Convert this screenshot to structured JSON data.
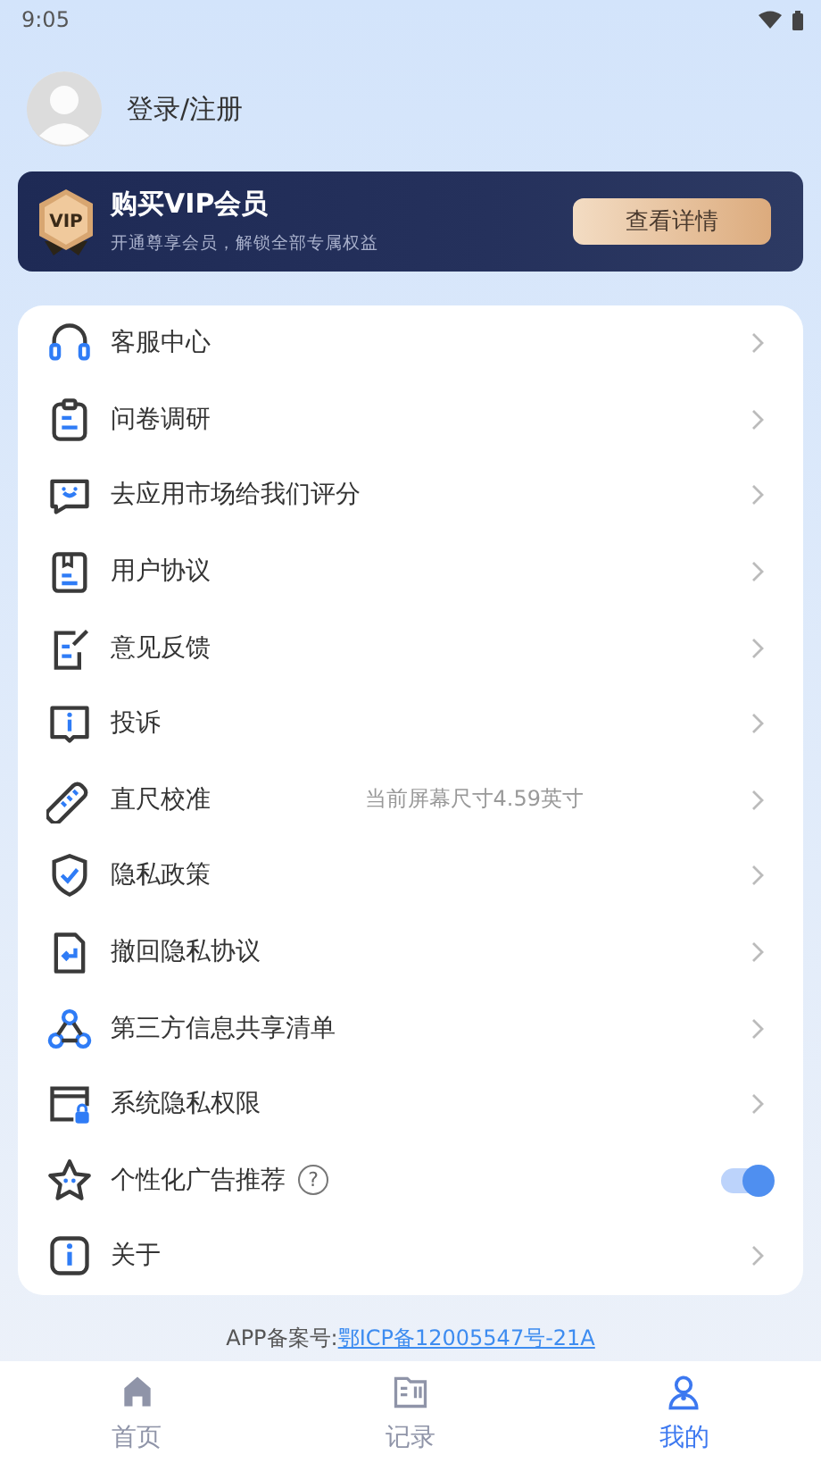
{
  "status_bar": {
    "time": "9:05"
  },
  "profile": {
    "name": "登录/注册"
  },
  "vip_banner": {
    "title": "购买VIP会员",
    "subtitle": "开通尊享会员，解锁全部专属权益",
    "button": "查看详情",
    "badge": "VIP"
  },
  "menu": [
    {
      "kind": "link",
      "label": "客服中心"
    },
    {
      "kind": "link",
      "label": "问卷调研"
    },
    {
      "kind": "link",
      "label": "去应用市场给我们评分"
    },
    {
      "kind": "link",
      "label": "用户协议"
    },
    {
      "kind": "link",
      "label": "意见反馈"
    },
    {
      "kind": "link",
      "label": "投诉"
    },
    {
      "kind": "link",
      "label": "直尺校准",
      "detail": "当前屏幕尺寸4.59英寸"
    },
    {
      "kind": "link",
      "label": "隐私政策"
    },
    {
      "kind": "link",
      "label": "撤回隐私协议"
    },
    {
      "kind": "link",
      "label": "第三方信息共享清单"
    },
    {
      "kind": "link",
      "label": "系统隐私权限"
    },
    {
      "kind": "toggle",
      "label": "个性化广告推荐",
      "help": "?",
      "on": true
    },
    {
      "kind": "link",
      "label": "关于"
    }
  ],
  "footer": {
    "label": "APP备案号:",
    "link": "鄂ICP备12005547号-21A"
  },
  "tabs": [
    {
      "label": "首页",
      "selected": false
    },
    {
      "label": "记录",
      "selected": false
    },
    {
      "label": "我的",
      "selected": true
    }
  ]
}
